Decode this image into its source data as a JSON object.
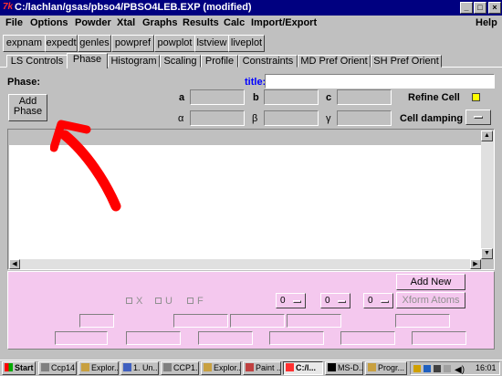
{
  "window": {
    "title": "C:/lachlan/gsas/pbso4/PBSO4LEB.EXP (modified)",
    "app_icon": "tk-feather-icon",
    "minimize": "_",
    "maximize": "□",
    "close": "×"
  },
  "menubar": [
    "File",
    "Options",
    "Powder",
    "Xtal",
    "Graphs",
    "Results",
    "Calc",
    "Import/Export",
    "Help"
  ],
  "toolbar": [
    "expnam",
    "expedt",
    "genles",
    "powpref",
    "powplot",
    "lstview",
    "liveplot"
  ],
  "tabs": [
    "LS Controls",
    "Phase",
    "Histogram",
    "Scaling",
    "Profile",
    "Constraints",
    "MD Pref Orient",
    "SH Pref Orient"
  ],
  "active_tab": "Phase",
  "phase": {
    "phase_label": "Phase:",
    "add_phase_line1": "Add",
    "add_phase_line2": "Phase",
    "title_label": "title:",
    "title_value": "",
    "cell_labels": {
      "a": "a",
      "b": "b",
      "c": "c",
      "alpha": "α",
      "beta": "β",
      "gamma": "γ"
    },
    "refine_cell_label": "Refine Cell",
    "cell_damping_label": "Cell damping"
  },
  "atoms": {
    "add_new_atoms": "Add New Atoms",
    "xform_atoms": "Xform Atoms",
    "checks": [
      "X",
      "U",
      "F"
    ],
    "menus": [
      "0",
      "0",
      "0"
    ]
  },
  "annotation": {
    "type": "red-arrow",
    "color": "#ff0000"
  },
  "colors": {
    "titlebar": "#000080",
    "window_bg": "#c0c0c0",
    "atom_edit_bg": "#f4c8ee",
    "title_label": "#0000ff",
    "refine_check": "#ffff00"
  },
  "taskbar": {
    "start": "Start",
    "tasks": [
      "Ccp14",
      "Explor...",
      "1. Un...",
      "CCP1...",
      "Explor...",
      "Paint ...",
      "C:/l...",
      "MS-D...",
      "Progr..."
    ],
    "active_task_index": 6,
    "clock": "16:01"
  }
}
